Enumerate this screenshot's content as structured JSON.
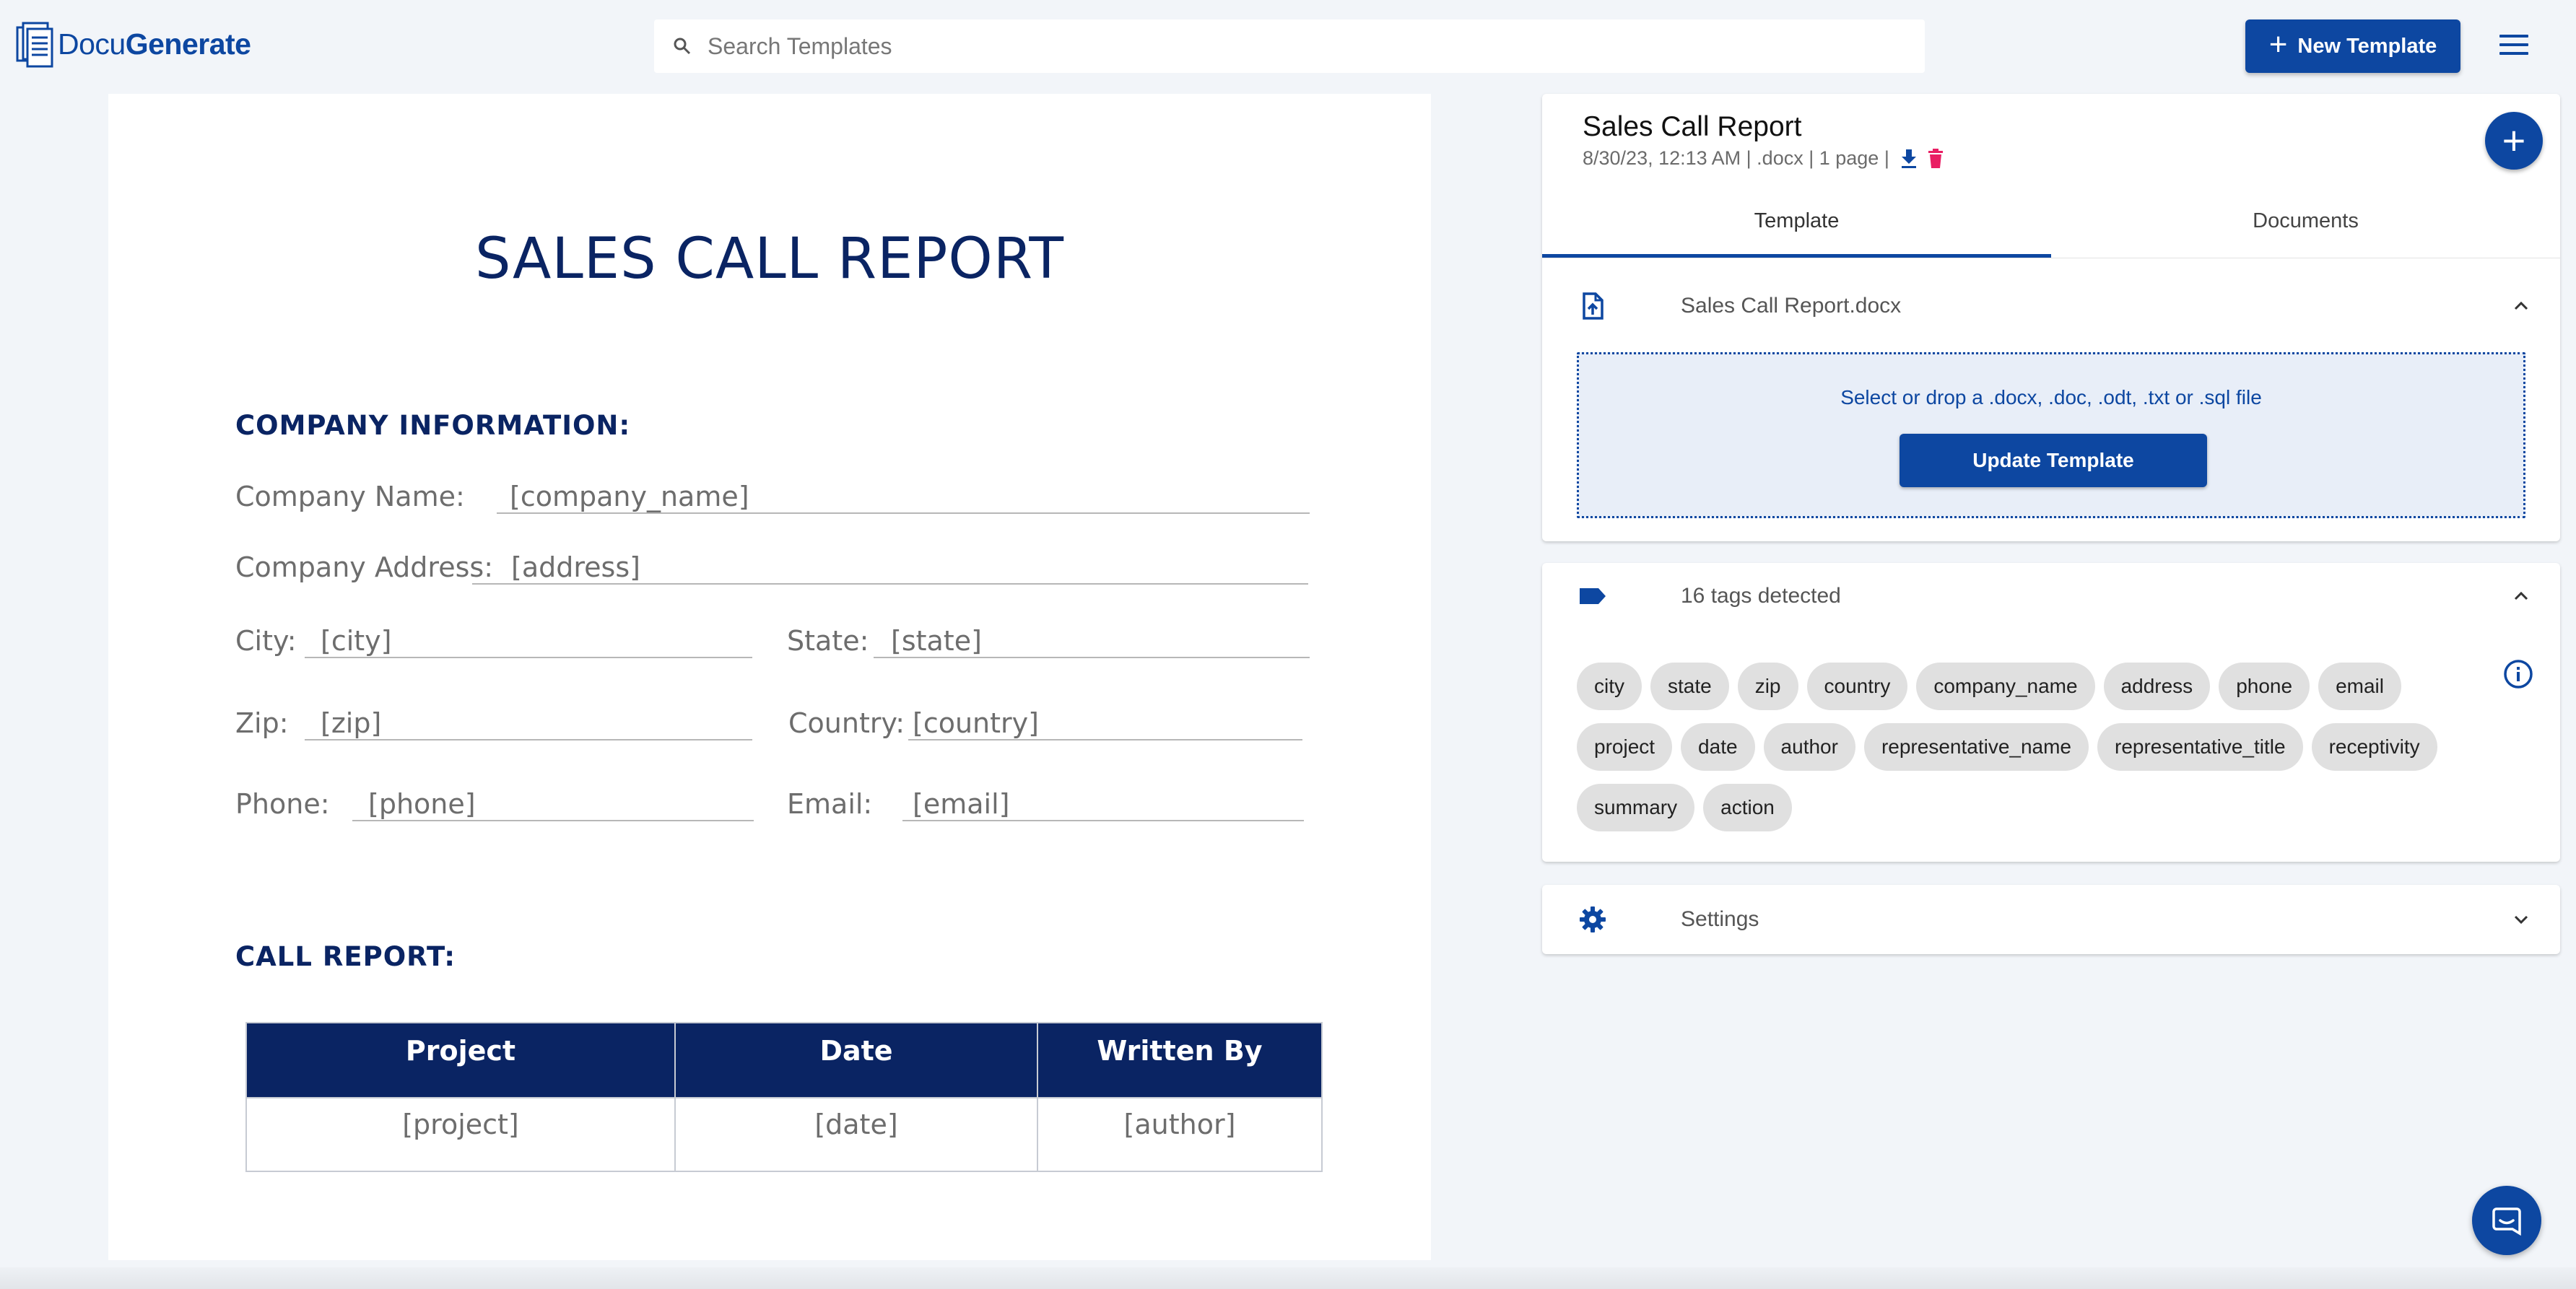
{
  "app": {
    "logo_part1": "Docu",
    "logo_part2": "Generate"
  },
  "search": {
    "placeholder": "Search Templates"
  },
  "header": {
    "new_template_label": "New Template"
  },
  "document": {
    "title": "SALES CALL REPORT",
    "company_heading": "COMPANY INFORMATION:",
    "fields": {
      "company_name_label": "Company Name:",
      "company_name_value": "[company_name]",
      "address_label": "Company Address:",
      "address_value": "[address]",
      "city_label": "City:",
      "city_value": "[city]",
      "state_label": "State:",
      "state_value": "[state]",
      "zip_label": "Zip:",
      "zip_value": "[zip]",
      "country_label": "Country:",
      "country_value": "[country]",
      "phone_label": "Phone:",
      "phone_value": "[phone]",
      "email_label": "Email:",
      "email_value": "[email]"
    },
    "call_heading": "CALL REPORT:",
    "table": {
      "headers": [
        "Project",
        "Date",
        "Written By"
      ],
      "row": [
        "[project]",
        "[date]",
        "[author]"
      ]
    }
  },
  "panel": {
    "template_name": "Sales Call Report",
    "meta": "8/30/23, 12:13 AM | .docx | 1 page |",
    "tabs": [
      "Template",
      "Documents"
    ],
    "file_name": "Sales Call Report.docx",
    "drop_text": "Select or drop a .docx, .doc, .odt, .txt or .sql file",
    "update_label": "Update Template",
    "tags_title": "16 tags detected",
    "tags": [
      "city",
      "state",
      "zip",
      "country",
      "company_name",
      "address",
      "phone",
      "email",
      "project",
      "date",
      "author",
      "representative_name",
      "representative_title",
      "receptivity",
      "summary",
      "action"
    ],
    "settings_label": "Settings"
  },
  "colors": {
    "brand": "#0d47a1",
    "doc_heading": "#0a2463",
    "delete": "#e91e63"
  }
}
